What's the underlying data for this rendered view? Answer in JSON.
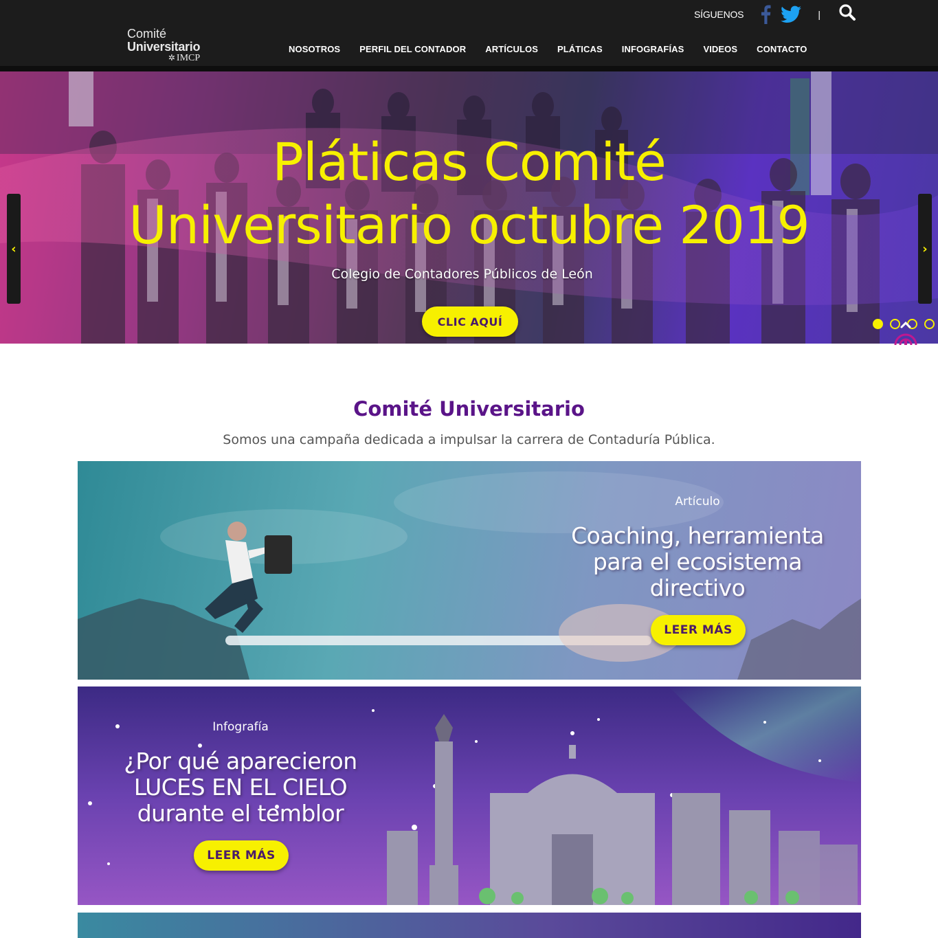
{
  "header": {
    "logo": {
      "line1": "Comité",
      "line2": "Universitario",
      "line3": "IMCP"
    },
    "siguenos": "SÍGUENOS",
    "separator": "|",
    "social_icons": [
      "facebook-icon",
      "twitter-icon"
    ],
    "search_icon": "search-icon",
    "nav": [
      "NOSOTROS",
      "PERFIL DEL CONTADOR",
      "ARTÍCULOS",
      "PLÁTICAS",
      "INFOGRAFÍAS",
      "VIDEOS",
      "CONTACTO"
    ]
  },
  "hero": {
    "title_line1": "Pláticas Comité",
    "title_line2": "Universitario octubre 2019",
    "subtitle": "Colegio de Contadores Públicos de León",
    "button": "CLIC AQUÍ",
    "slides_total": 4,
    "active_slide": 1
  },
  "intro": {
    "title": "Comité Universitario",
    "text": "Somos una campaña dedicada a impulsar la carrera de Contaduría Pública."
  },
  "cards": [
    {
      "category": "Artículo",
      "title_lines": [
        "Coaching, herramienta",
        "para el ecosistema",
        "directivo"
      ],
      "button": "LEER MÁS"
    },
    {
      "category": "Infografía",
      "title_lines": [
        "¿Por qué aparecieron",
        "LUCES EN EL CIELO",
        "durante el temblor"
      ],
      "button": "LEER MÁS"
    }
  ],
  "colors": {
    "accent_yellow": "#f7f000",
    "header_bg": "#1c1c1c",
    "purple_title": "#5a1488",
    "facebook_blue": "#3b5998",
    "twitter_blue": "#1da1f2"
  }
}
